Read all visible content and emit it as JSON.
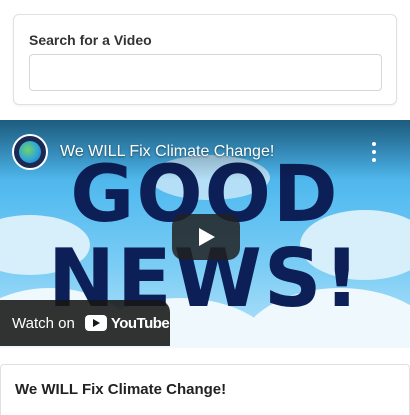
{
  "search": {
    "label": "Search for a Video",
    "value": "",
    "placeholder": ""
  },
  "video": {
    "title": "We WILL Fix Climate Change!",
    "thumbnail_line1": "GOOD",
    "thumbnail_line2": "NEWS!",
    "watch_on_label": "Watch on",
    "youtube_label": "YouTube",
    "icons": [
      "channel-logo-icon",
      "more-options-icon",
      "play-icon",
      "youtube-logo-icon"
    ]
  },
  "result_card": {
    "title": "We WILL Fix Climate Change!"
  },
  "colors": {
    "thumbnail_text": "#0c1f57",
    "sky": "#58bdf0"
  }
}
